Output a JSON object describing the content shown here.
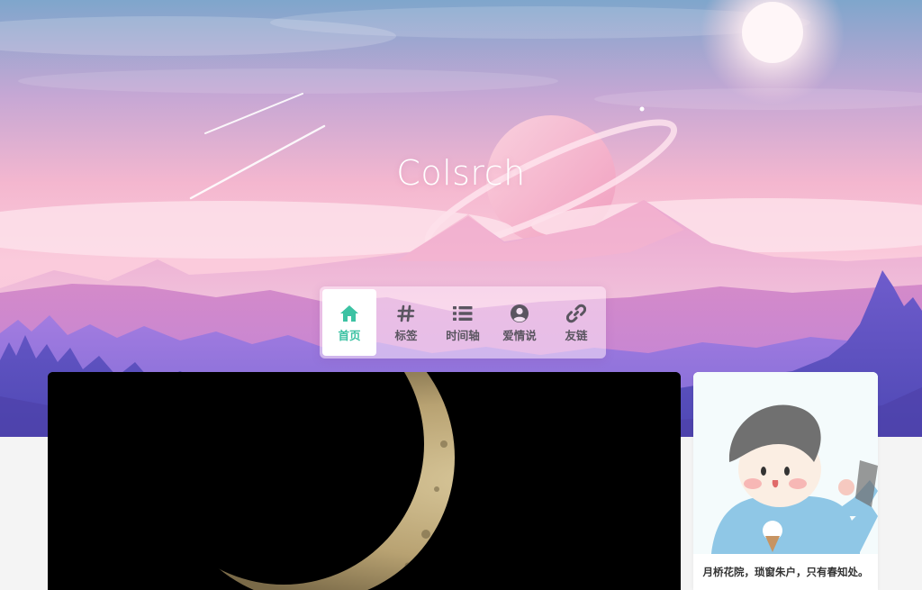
{
  "site": {
    "title": "Colsrch"
  },
  "nav": {
    "items": [
      {
        "label": "首页",
        "icon": "home-icon",
        "active": true
      },
      {
        "label": "标签",
        "icon": "hash-icon",
        "active": false
      },
      {
        "label": "时间轴",
        "icon": "list-icon",
        "active": false
      },
      {
        "label": "爱情说",
        "icon": "user-circle-icon",
        "active": false
      },
      {
        "label": "友链",
        "icon": "link-icon",
        "active": false
      }
    ]
  },
  "sidebar": {
    "motto": "月桥花院，琐窗朱户，只有春知处。"
  },
  "colors": {
    "accent": "#3cc2a3",
    "nav_text": "#5a5560",
    "page_bg": "#f4f4f4"
  }
}
